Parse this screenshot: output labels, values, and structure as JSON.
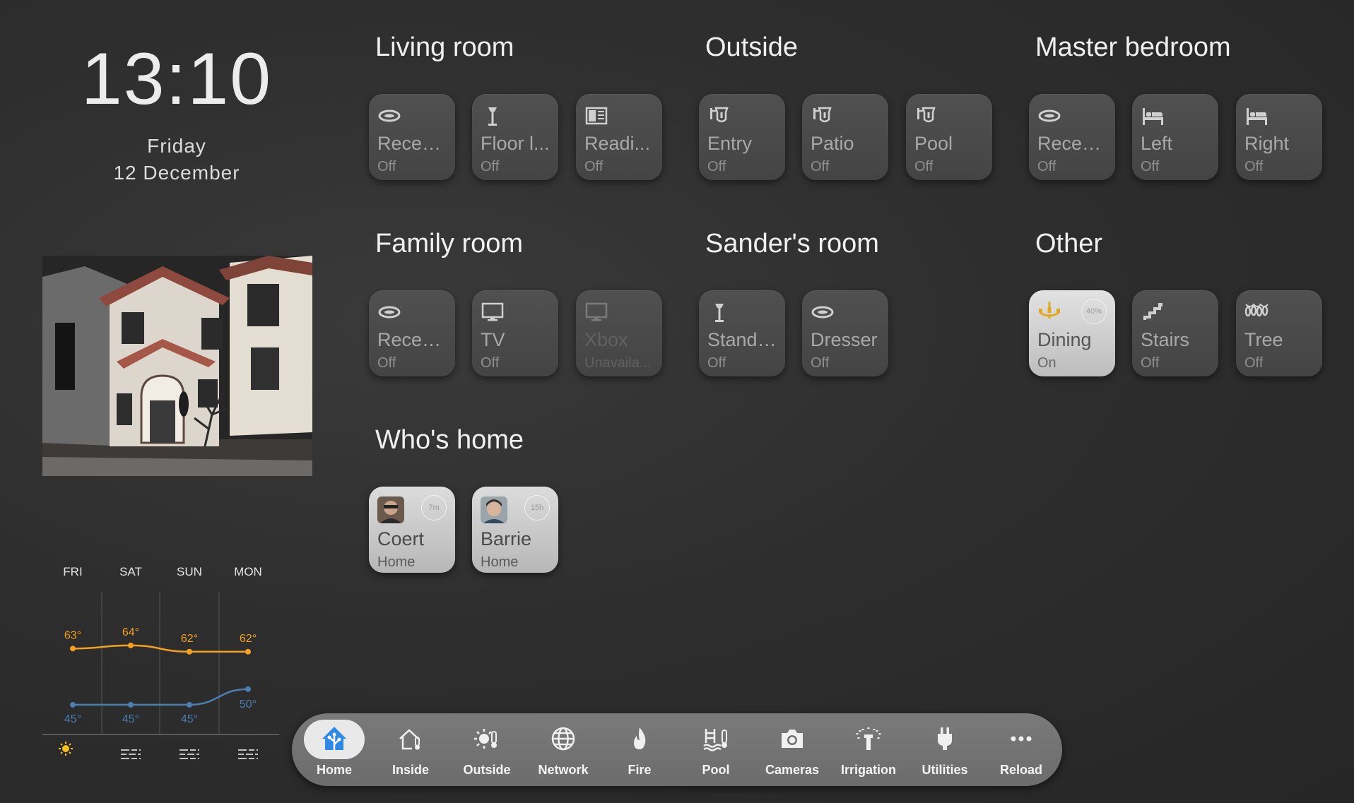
{
  "clock": {
    "time": "13:10",
    "day": "Friday",
    "date": "12 December"
  },
  "weather": {
    "days": [
      "FRI",
      "SAT",
      "SUN",
      "MON"
    ],
    "highs": [
      63,
      64,
      62,
      62
    ],
    "lows": [
      45,
      45,
      45,
      50
    ],
    "high_labels": [
      "63°",
      "64°",
      "62°",
      "62°"
    ],
    "low_labels": [
      "45°",
      "45°",
      "45°",
      "50°"
    ],
    "conditions": [
      "sunny-icon",
      "fog-icon",
      "fog-icon",
      "fog-icon"
    ],
    "colors": {
      "high": "#f4a020",
      "low": "#4a7fb0"
    }
  },
  "sections": {
    "living": {
      "title": "Living room",
      "tiles": [
        {
          "name": "Reces...",
          "state": "Off",
          "icon": "recessed-light-icon"
        },
        {
          "name": "Floor l...",
          "state": "Off",
          "icon": "floor-lamp-icon"
        },
        {
          "name": "Readi...",
          "state": "Off",
          "icon": "reading-light-icon"
        }
      ]
    },
    "outside": {
      "title": "Outside",
      "tiles": [
        {
          "name": "Entry",
          "state": "Off",
          "icon": "wall-lantern-icon"
        },
        {
          "name": "Patio",
          "state": "Off",
          "icon": "wall-lantern-icon"
        },
        {
          "name": "Pool",
          "state": "Off",
          "icon": "wall-lantern-icon"
        }
      ]
    },
    "master": {
      "title": "Master bedroom",
      "tiles": [
        {
          "name": "Reces...",
          "state": "Off",
          "icon": "recessed-light-icon"
        },
        {
          "name": "Left",
          "state": "Off",
          "icon": "bed-icon"
        },
        {
          "name": "Right",
          "state": "Off",
          "icon": "bed-icon"
        }
      ]
    },
    "family": {
      "title": "Family room",
      "tiles": [
        {
          "name": "Reces...",
          "state": "Off",
          "icon": "recessed-light-icon"
        },
        {
          "name": "TV",
          "state": "Off",
          "icon": "tv-icon"
        },
        {
          "name": "Xbox",
          "state": "Unavaila...",
          "icon": "monitor-icon"
        }
      ]
    },
    "sander": {
      "title": "Sander's room",
      "tiles": [
        {
          "name": "Standi...",
          "state": "Off",
          "icon": "floor-lamp-icon"
        },
        {
          "name": "Dresser",
          "state": "Off",
          "icon": "recessed-light-icon"
        }
      ]
    },
    "other": {
      "title": "Other",
      "tiles": [
        {
          "name": "Dining",
          "state": "On",
          "icon": "chandelier-icon",
          "badge": "40%"
        },
        {
          "name": "Stairs",
          "state": "Off",
          "icon": "stairs-icon"
        },
        {
          "name": "Tree",
          "state": "Off",
          "icon": "string-lights-icon"
        }
      ]
    },
    "who": {
      "title": "Who's home",
      "people": [
        {
          "name": "Coert",
          "state": "Home",
          "badge": "7m"
        },
        {
          "name": "Barrie",
          "state": "Home",
          "badge": "15h"
        }
      ]
    }
  },
  "nav": {
    "items": [
      "Home",
      "Inside",
      "Outside",
      "Network",
      "Fire",
      "Pool",
      "Cameras",
      "Irrigation",
      "Utilities",
      "Reload"
    ],
    "active": "Home",
    "accent": "#2f8ae5"
  }
}
